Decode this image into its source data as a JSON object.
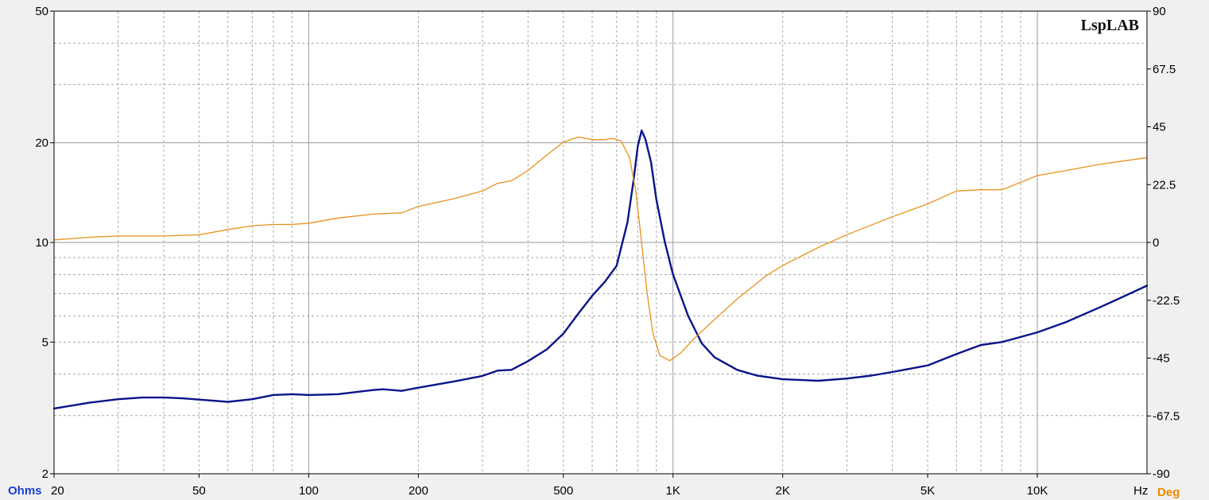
{
  "watermark": "LspLAB",
  "chart_data": {
    "type": "line",
    "title": "",
    "x_scale": "log",
    "x_range": [
      20,
      20000
    ],
    "x_tick_labels": [
      {
        "value": 20,
        "label": "20"
      },
      {
        "value": 50,
        "label": "50"
      },
      {
        "value": 100,
        "label": "100"
      },
      {
        "value": 200,
        "label": "200"
      },
      {
        "value": 500,
        "label": "500"
      },
      {
        "value": 1000,
        "label": "1K"
      },
      {
        "value": 2000,
        "label": "2K"
      },
      {
        "value": 5000,
        "label": "5K"
      },
      {
        "value": 10000,
        "label": "10K"
      }
    ],
    "x_unit": "Hz",
    "y_left": {
      "unit": "Ohms",
      "scale": "log",
      "range": [
        2,
        50
      ],
      "ticks": [
        {
          "value": 2,
          "label": "2"
        },
        {
          "value": 5,
          "label": "5"
        },
        {
          "value": 10,
          "label": "10"
        },
        {
          "value": 20,
          "label": "20"
        },
        {
          "value": 50,
          "label": "50"
        }
      ]
    },
    "y_right": {
      "unit": "Deg",
      "scale": "linear",
      "range": [
        -90,
        90
      ],
      "ticks": [
        {
          "value": 90,
          "label": "90"
        },
        {
          "value": 67.5,
          "label": "67.5"
        },
        {
          "value": 45,
          "label": "45"
        },
        {
          "value": 22.5,
          "label": "22.5"
        },
        {
          "value": 0,
          "label": "0"
        },
        {
          "value": -22.5,
          "label": "-22.5"
        },
        {
          "value": -45,
          "label": "-45"
        },
        {
          "value": -67.5,
          "label": "-67.5"
        },
        {
          "value": -90,
          "label": "-90"
        }
      ]
    },
    "grid": true,
    "series": [
      {
        "axis": "left",
        "color": "#0a1489",
        "points": [
          [
            20,
            3.15
          ],
          [
            25,
            3.28
          ],
          [
            30,
            3.36
          ],
          [
            35,
            3.4
          ],
          [
            40,
            3.4
          ],
          [
            45,
            3.38
          ],
          [
            50,
            3.35
          ],
          [
            60,
            3.3
          ],
          [
            70,
            3.36
          ],
          [
            80,
            3.46
          ],
          [
            90,
            3.48
          ],
          [
            100,
            3.46
          ],
          [
            120,
            3.48
          ],
          [
            150,
            3.58
          ],
          [
            160,
            3.6
          ],
          [
            180,
            3.56
          ],
          [
            200,
            3.64
          ],
          [
            250,
            3.8
          ],
          [
            300,
            3.95
          ],
          [
            330,
            4.1
          ],
          [
            360,
            4.12
          ],
          [
            400,
            4.38
          ],
          [
            450,
            4.75
          ],
          [
            500,
            5.3
          ],
          [
            550,
            6.1
          ],
          [
            600,
            6.9
          ],
          [
            650,
            7.6
          ],
          [
            700,
            8.5
          ],
          [
            750,
            11.5
          ],
          [
            780,
            15.5
          ],
          [
            800,
            19.5
          ],
          [
            820,
            21.8
          ],
          [
            840,
            20.5
          ],
          [
            870,
            17.5
          ],
          [
            900,
            13.5
          ],
          [
            950,
            10.0
          ],
          [
            1000,
            8.0
          ],
          [
            1100,
            6.0
          ],
          [
            1200,
            4.95
          ],
          [
            1300,
            4.5
          ],
          [
            1500,
            4.12
          ],
          [
            1700,
            3.96
          ],
          [
            2000,
            3.86
          ],
          [
            2500,
            3.82
          ],
          [
            3000,
            3.88
          ],
          [
            3500,
            3.96
          ],
          [
            4000,
            4.06
          ],
          [
            5000,
            4.25
          ],
          [
            6000,
            4.6
          ],
          [
            7000,
            4.9
          ],
          [
            8000,
            5.0
          ],
          [
            10000,
            5.35
          ],
          [
            12000,
            5.75
          ],
          [
            15000,
            6.4
          ],
          [
            20000,
            7.4
          ]
        ]
      },
      {
        "axis": "right",
        "color": "#e8911c",
        "points": [
          [
            20,
            1
          ],
          [
            25,
            2
          ],
          [
            30,
            2.5
          ],
          [
            40,
            2.5
          ],
          [
            50,
            3
          ],
          [
            60,
            5
          ],
          [
            70,
            6.5
          ],
          [
            80,
            7
          ],
          [
            90,
            7
          ],
          [
            100,
            7.5
          ],
          [
            120,
            9.5
          ],
          [
            150,
            11
          ],
          [
            180,
            11.5
          ],
          [
            200,
            14
          ],
          [
            250,
            17
          ],
          [
            300,
            20
          ],
          [
            330,
            23
          ],
          [
            360,
            24
          ],
          [
            400,
            28
          ],
          [
            450,
            34
          ],
          [
            500,
            39
          ],
          [
            550,
            41
          ],
          [
            600,
            40
          ],
          [
            650,
            40
          ],
          [
            680,
            40.5
          ],
          [
            720,
            39.5
          ],
          [
            760,
            33
          ],
          [
            790,
            20
          ],
          [
            820,
            0
          ],
          [
            850,
            -20
          ],
          [
            880,
            -35
          ],
          [
            920,
            -44
          ],
          [
            980,
            -46
          ],
          [
            1050,
            -43
          ],
          [
            1150,
            -37
          ],
          [
            1300,
            -30
          ],
          [
            1500,
            -22
          ],
          [
            1800,
            -13
          ],
          [
            2000,
            -9
          ],
          [
            2500,
            -2
          ],
          [
            3000,
            3
          ],
          [
            4000,
            10
          ],
          [
            5000,
            15
          ],
          [
            6000,
            20
          ],
          [
            7000,
            20.5
          ],
          [
            8000,
            20.5
          ],
          [
            10000,
            26
          ],
          [
            12000,
            28
          ],
          [
            15000,
            30.5
          ],
          [
            20000,
            33
          ]
        ]
      }
    ]
  }
}
